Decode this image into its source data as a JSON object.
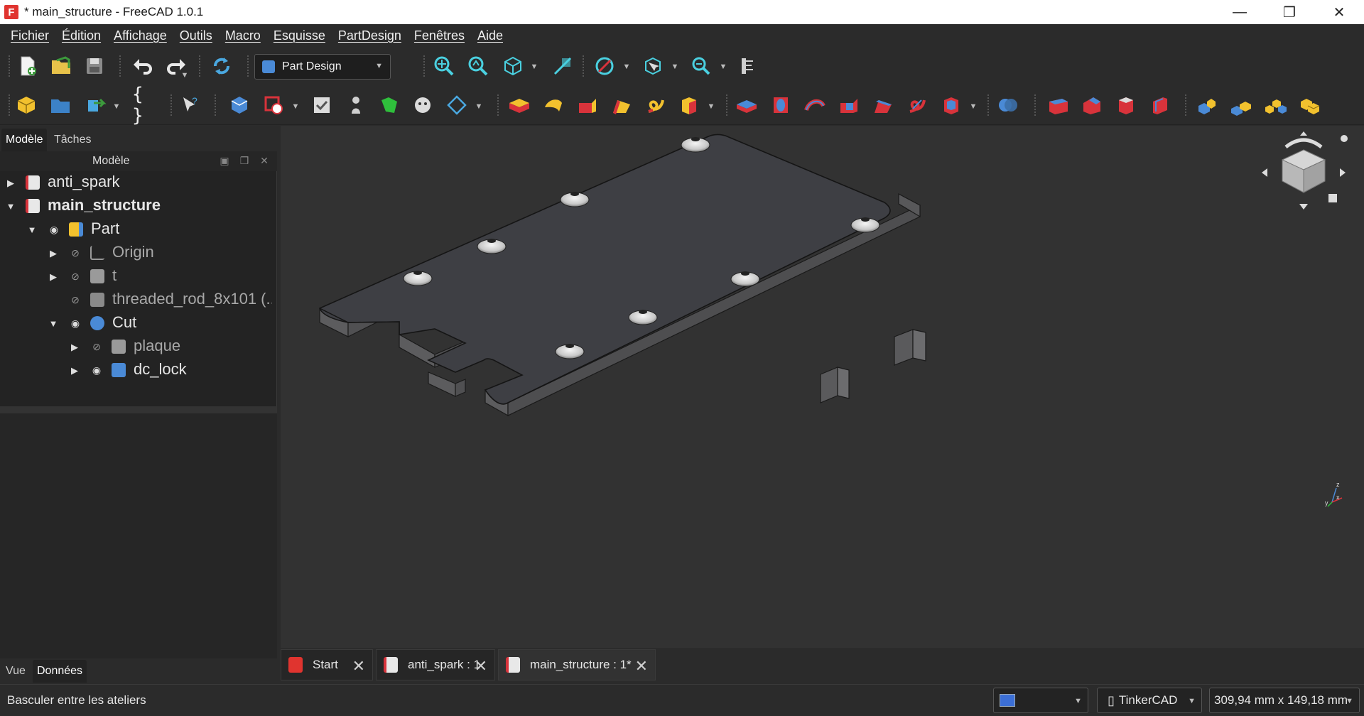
{
  "window": {
    "title": "* main_structure - FreeCAD 1.0.1",
    "app_icon": "freecad-logo",
    "controls": {
      "minimize": "—",
      "restore": "❐",
      "close": "✕"
    }
  },
  "menu": [
    "Fichier",
    "Édition",
    "Affichage",
    "Outils",
    "Macro",
    "Esquisse",
    "PartDesign",
    "Fenêtres",
    "Aide"
  ],
  "toolbar": {
    "workbench": "Part Design"
  },
  "left_panel": {
    "tabs": [
      "Modèle",
      "Tâches"
    ],
    "header": "Modèle",
    "tree": [
      {
        "label": "anti_spark",
        "bold": false,
        "expanded": false
      },
      {
        "label": "main_structure",
        "bold": true,
        "expanded": true
      },
      {
        "label": "Part",
        "expanded": true
      },
      {
        "label": "Origin",
        "hidden": true
      },
      {
        "label": "t",
        "hidden": true
      },
      {
        "label": "threaded_rod_8x101 (..",
        "hidden": true
      },
      {
        "label": "Cut",
        "expanded": true
      },
      {
        "label": "plaque",
        "hidden": true
      },
      {
        "label": "dc_lock",
        "hidden": false
      }
    ],
    "bottom_tabs": [
      "Vue",
      "Données"
    ]
  },
  "doc_tabs": [
    {
      "label": "Start",
      "active": false
    },
    {
      "label": "anti_spark : 1",
      "active": false
    },
    {
      "label": "main_structure : 1*",
      "active": true
    }
  ],
  "status": {
    "message": "Basculer entre les ateliers",
    "navigation": "TinkerCAD",
    "dimensions": "309,94 mm x 149,18 mm"
  },
  "colors": {
    "background": "#2b2b2b",
    "viewport": "#323232",
    "accent_blue": "#4a8ad6",
    "part_yellow": "#f2c12e",
    "feature_red": "#d8333b"
  }
}
